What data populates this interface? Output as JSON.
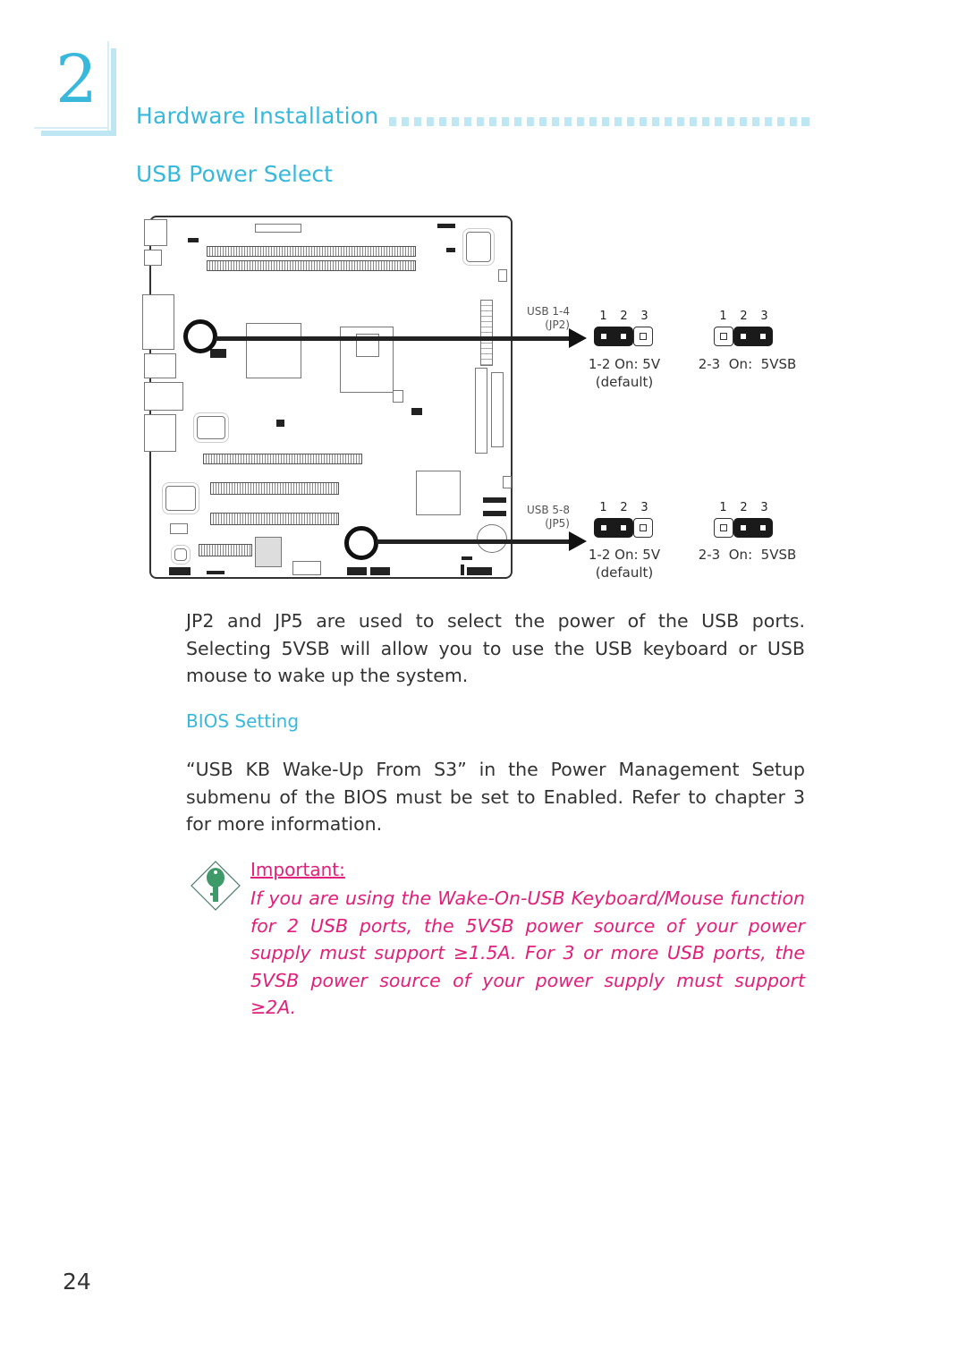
{
  "chapter": {
    "number": "2",
    "title": "Hardware Installation"
  },
  "section": {
    "title": "USB Power Select"
  },
  "diagram": {
    "jumpers": [
      {
        "label_line1": "USB 1-4",
        "label_line2": "(JP2)",
        "options": [
          {
            "pins": [
              "1",
              "2",
              "3"
            ],
            "shorted": [
              1,
              2
            ],
            "setting": "1-2 On: 5V",
            "note": "(default)"
          },
          {
            "pins": [
              "1",
              "2",
              "3"
            ],
            "shorted": [
              2,
              3
            ],
            "setting": "2-3  On:  5VSB",
            "note": ""
          }
        ]
      },
      {
        "label_line1": "USB 5-8",
        "label_line2": "(JP5)",
        "options": [
          {
            "pins": [
              "1",
              "2",
              "3"
            ],
            "shorted": [
              1,
              2
            ],
            "setting": "1-2 On: 5V",
            "note": "(default)"
          },
          {
            "pins": [
              "1",
              "2",
              "3"
            ],
            "shorted": [
              2,
              3
            ],
            "setting": "2-3  On:  5VSB",
            "note": ""
          }
        ]
      }
    ]
  },
  "body": {
    "paragraph1": "JP2 and JP5 are used to select the power of the USB ports. Selecting 5VSB will allow you to use the USB keyboard or USB mouse to wake up the system.",
    "bios_heading": "BIOS Setting",
    "paragraph2": "“USB KB Wake-Up From S3” in the Power Management Setup submenu of the BIOS must be set to Enabled. Refer to chapter 3 for more information."
  },
  "important": {
    "icon": "key-icon",
    "label": "Important:",
    "text": "If you are using the Wake-On-USB Keyboard/Mouse function for 2 USB ports, the 5VSB power source of your power supply must support ≥1.5A. For 3 or more USB ports, the 5VSB power source of your power supply must support ≥2A."
  },
  "footer": {
    "page_number": "24"
  },
  "colors": {
    "accent": "#3ab8dc",
    "important": "#e0207a",
    "key_icon": "#3f9a6a"
  }
}
